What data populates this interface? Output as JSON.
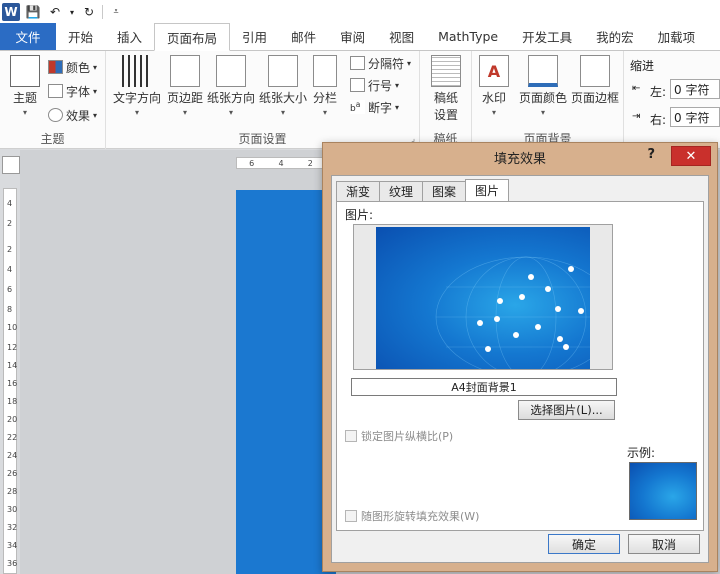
{
  "app": {
    "logo": "W"
  },
  "tabs": [
    {
      "label": "文件"
    },
    {
      "label": "开始"
    },
    {
      "label": "插入"
    },
    {
      "label": "页面布局"
    },
    {
      "label": "引用"
    },
    {
      "label": "邮件"
    },
    {
      "label": "审阅"
    },
    {
      "label": "视图"
    },
    {
      "label": "MathType"
    },
    {
      "label": "开发工具"
    },
    {
      "label": "我的宏"
    },
    {
      "label": "加载项"
    }
  ],
  "ribbon": {
    "theme": {
      "main": "主题",
      "colors": "颜色",
      "fonts": "字体",
      "effects": "效果",
      "group": "主题"
    },
    "page_setup": {
      "text_direction": "文字方向",
      "margins": "页边距",
      "orientation": "纸张方向",
      "size": "纸张大小",
      "columns": "分栏",
      "breaks": "分隔符",
      "line_numbers": "行号",
      "hyphenation": "断字",
      "group": "页面设置"
    },
    "manuscript": {
      "label1": "稿纸",
      "label2": "设置",
      "group": "稿纸"
    },
    "page_background": {
      "watermark": "水印",
      "page_color": "页面颜色",
      "page_borders": "页面边框",
      "group": "页面背景"
    },
    "indent": {
      "title": "缩进",
      "left_label": "左:",
      "left_value": "0 字符",
      "right_label": "右:",
      "right_value": "0 字符"
    }
  },
  "ruler": {
    "h1": "6",
    "h2": "4",
    "h3": "2",
    "v": [
      "4",
      "2",
      "2",
      "4",
      "6",
      "8",
      "10",
      "12",
      "14",
      "16",
      "18",
      "20",
      "22",
      "24",
      "26",
      "28",
      "30",
      "32",
      "34",
      "36"
    ]
  },
  "dialog": {
    "title": "填充效果",
    "help": "?",
    "close": "✕",
    "tabs": [
      {
        "label": "渐变"
      },
      {
        "label": "纹理"
      },
      {
        "label": "图案"
      },
      {
        "label": "图片"
      }
    ],
    "picture_label": "图片:",
    "picture_name": "A4封面背景1",
    "choose_button": "选择图片(L)...",
    "lock_aspect": "锁定图片纵横比(P)",
    "rotate_with_shape": "随图形旋转填充效果(W)",
    "sample_label": "示例:",
    "ok": "确定",
    "cancel": "取消"
  }
}
